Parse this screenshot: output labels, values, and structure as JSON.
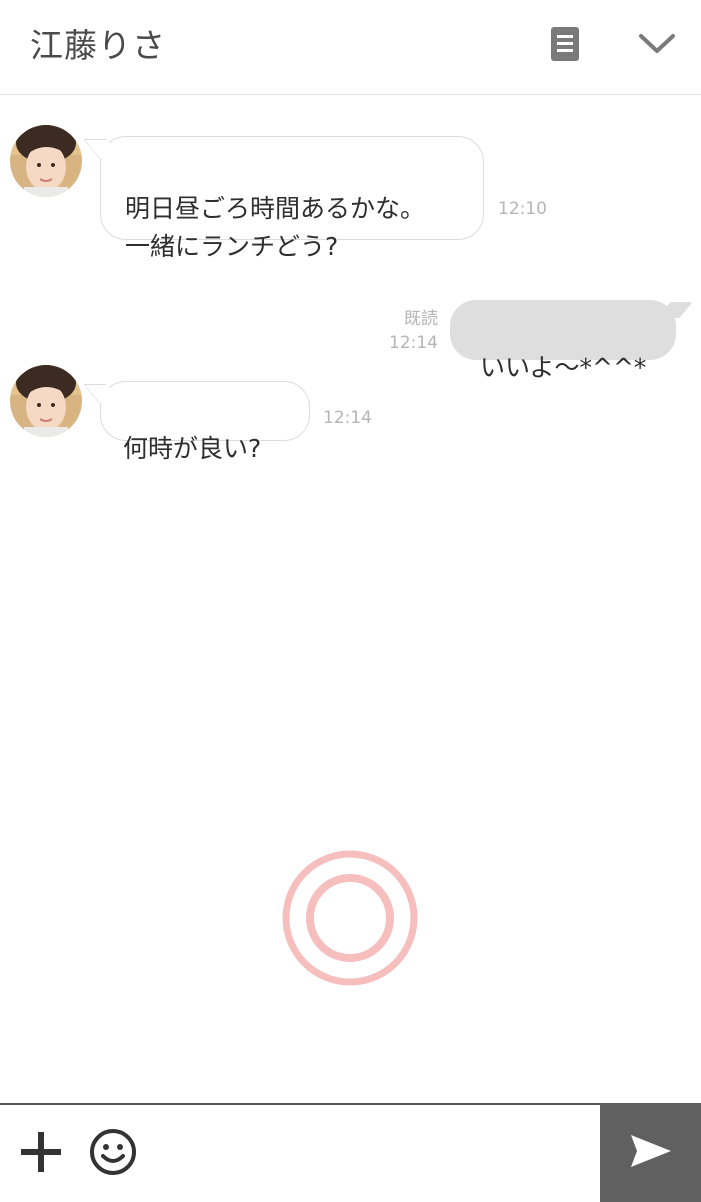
{
  "header": {
    "title": "江藤りさ",
    "notes_icon": "notes-icon",
    "collapse_icon": "chevron-down-icon"
  },
  "messages": [
    {
      "direction": "received",
      "text": "明日昼ごろ時間あるかな。\n一緒にランチどう?",
      "time": "12:10"
    },
    {
      "direction": "sent",
      "text": "いいよ〜*^^*",
      "read_label": "既読",
      "time": "12:14"
    },
    {
      "direction": "received",
      "text": "何時が良い?",
      "time": "12:14"
    }
  ],
  "composer": {
    "plus_icon": "plus-icon",
    "emoji_icon": "smiley-icon",
    "send_icon": "send-icon",
    "input_value": "",
    "input_placeholder": ""
  },
  "colors": {
    "header_text": "#4a4a4a",
    "sent_bubble": "#dedede",
    "received_border": "#dcdcdc",
    "meta_text": "#b5b5b5",
    "loader": "#f6b7b7",
    "send_button": "#606060"
  }
}
